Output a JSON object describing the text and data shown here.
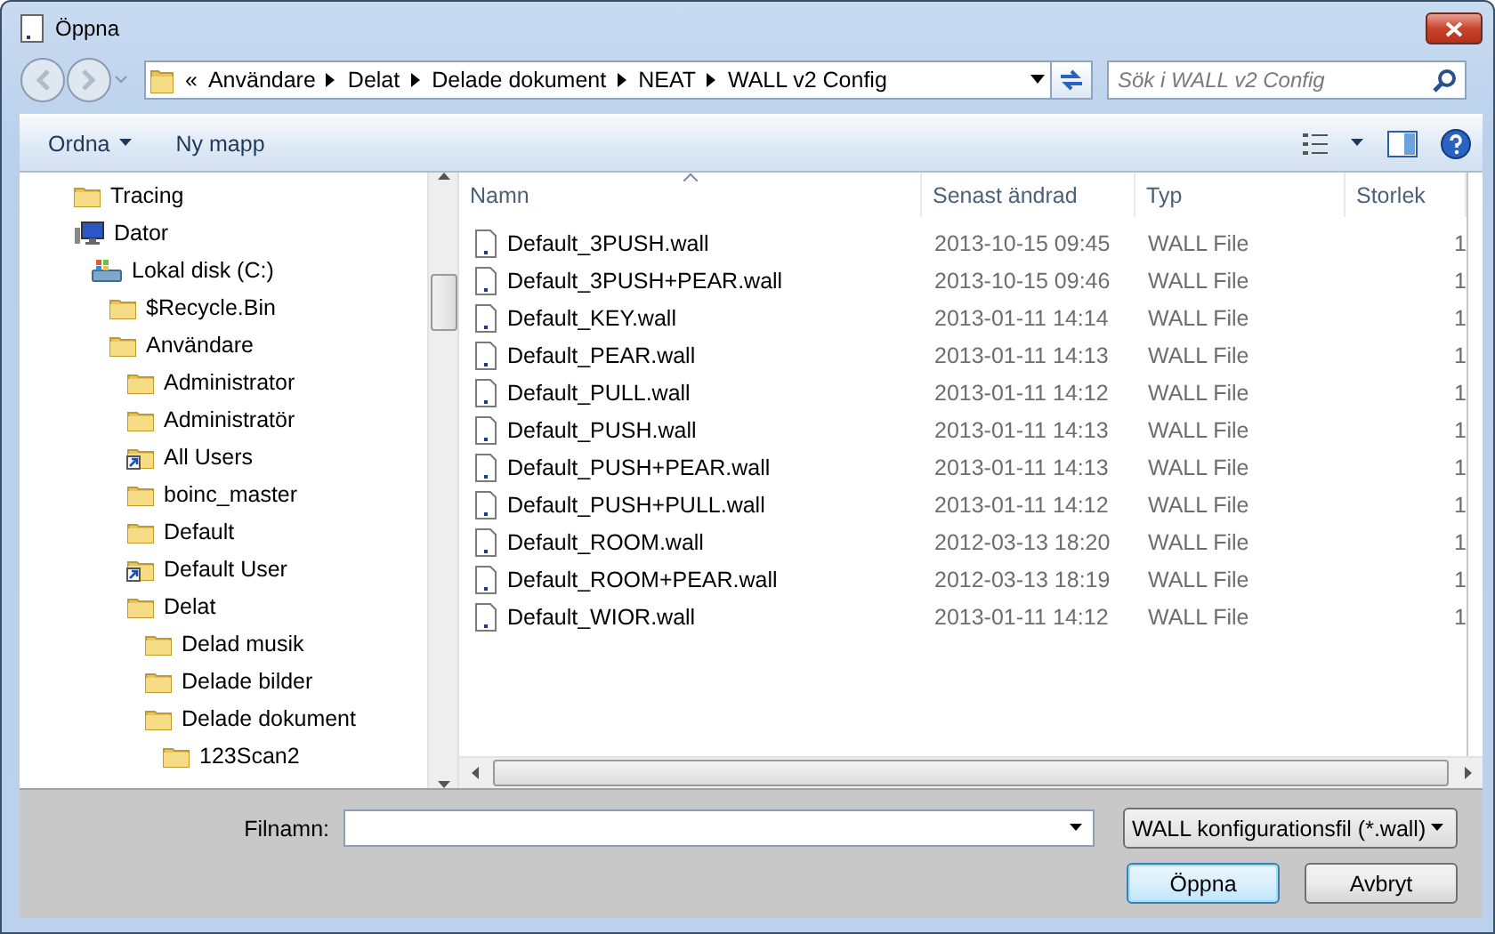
{
  "window": {
    "title": "Öppna"
  },
  "address": {
    "overflow": "«",
    "crumbs": [
      "Användare",
      "Delat",
      "Delade dokument",
      "NEAT",
      "WALL v2 Config"
    ]
  },
  "search": {
    "placeholder": "Sök i WALL v2 Config"
  },
  "toolbar": {
    "items": [
      {
        "label": "Ordna",
        "kind": "menu"
      },
      {
        "label": "Ny mapp",
        "kind": "button"
      }
    ]
  },
  "tree": {
    "items": [
      {
        "label": "Tracing",
        "kind": "folder"
      },
      {
        "label": "Dator",
        "kind": "computer",
        "children": [
          {
            "label": "Lokal disk (C:)",
            "kind": "drive",
            "children": [
              {
                "label": "$Recycle.Bin",
                "kind": "folder"
              },
              {
                "label": "Användare",
                "kind": "folder",
                "children": [
                  {
                    "label": "Administrator",
                    "kind": "folder"
                  },
                  {
                    "label": "Administratör",
                    "kind": "folder"
                  },
                  {
                    "label": "All Users",
                    "kind": "shortcut"
                  },
                  {
                    "label": "boinc_master",
                    "kind": "folder"
                  },
                  {
                    "label": "Default",
                    "kind": "folder"
                  },
                  {
                    "label": "Default User",
                    "kind": "shortcut"
                  },
                  {
                    "label": "Delat",
                    "kind": "folder",
                    "children": [
                      {
                        "label": "Delad musik",
                        "kind": "folder"
                      },
                      {
                        "label": "Delade bilder",
                        "kind": "folder"
                      },
                      {
                        "label": "Delade dokument",
                        "kind": "folder",
                        "children": [
                          {
                            "label": "123Scan2",
                            "kind": "folder"
                          }
                        ]
                      }
                    ]
                  }
                ]
              }
            ]
          }
        ]
      }
    ]
  },
  "file_list": {
    "columns": [
      {
        "label": "Namn",
        "sorted": true
      },
      {
        "label": "Senast ändrad",
        "sorted": false
      },
      {
        "label": "Typ",
        "sorted": false
      },
      {
        "label": "Storlek",
        "sorted": false
      }
    ],
    "rows": [
      {
        "name": "Default_3PUSH.wall",
        "modified": "2013-10-15 09:45",
        "type": "WALL File",
        "size": "1"
      },
      {
        "name": "Default_3PUSH+PEAR.wall",
        "modified": "2013-10-15 09:46",
        "type": "WALL File",
        "size": "1"
      },
      {
        "name": "Default_KEY.wall",
        "modified": "2013-01-11 14:14",
        "type": "WALL File",
        "size": "1"
      },
      {
        "name": "Default_PEAR.wall",
        "modified": "2013-01-11 14:13",
        "type": "WALL File",
        "size": "1"
      },
      {
        "name": "Default_PULL.wall",
        "modified": "2013-01-11 14:12",
        "type": "WALL File",
        "size": "1"
      },
      {
        "name": "Default_PUSH.wall",
        "modified": "2013-01-11 14:13",
        "type": "WALL File",
        "size": "1"
      },
      {
        "name": "Default_PUSH+PEAR.wall",
        "modified": "2013-01-11 14:13",
        "type": "WALL File",
        "size": "1"
      },
      {
        "name": "Default_PUSH+PULL.wall",
        "modified": "2013-01-11 14:12",
        "type": "WALL File",
        "size": "1"
      },
      {
        "name": "Default_ROOM.wall",
        "modified": "2012-03-13 18:20",
        "type": "WALL File",
        "size": "1"
      },
      {
        "name": "Default_ROOM+PEAR.wall",
        "modified": "2012-03-13 18:19",
        "type": "WALL File",
        "size": "1"
      },
      {
        "name": "Default_WIOR.wall",
        "modified": "2013-01-11 14:12",
        "type": "WALL File",
        "size": "1"
      }
    ]
  },
  "footer": {
    "filename": {
      "label": "Filnamn:"
    },
    "filter": {
      "value": "WALL konfigurationsfil (*.wall)"
    },
    "buttons": [
      {
        "label": "Öppna",
        "default": true
      },
      {
        "label": "Avbryt",
        "default": false
      }
    ]
  }
}
